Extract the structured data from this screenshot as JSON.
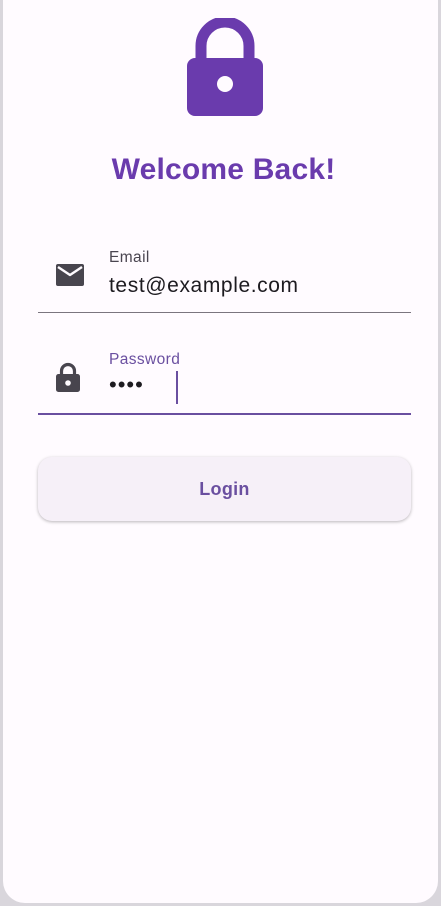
{
  "header": {
    "hero_icon": "lock-icon",
    "title": "Welcome Back!"
  },
  "form": {
    "email": {
      "icon": "mail-icon",
      "label": "Email",
      "value": "test@example.com"
    },
    "password": {
      "icon": "lock-icon",
      "label": "Password",
      "value": "••••",
      "focused": true
    },
    "login_button": "Login"
  },
  "colors": {
    "accent": "#6a3bad",
    "focused_label": "#6a4fa0",
    "background": "#fffbff",
    "button_bg": "#f6f0f8",
    "icon": "#48454e"
  }
}
